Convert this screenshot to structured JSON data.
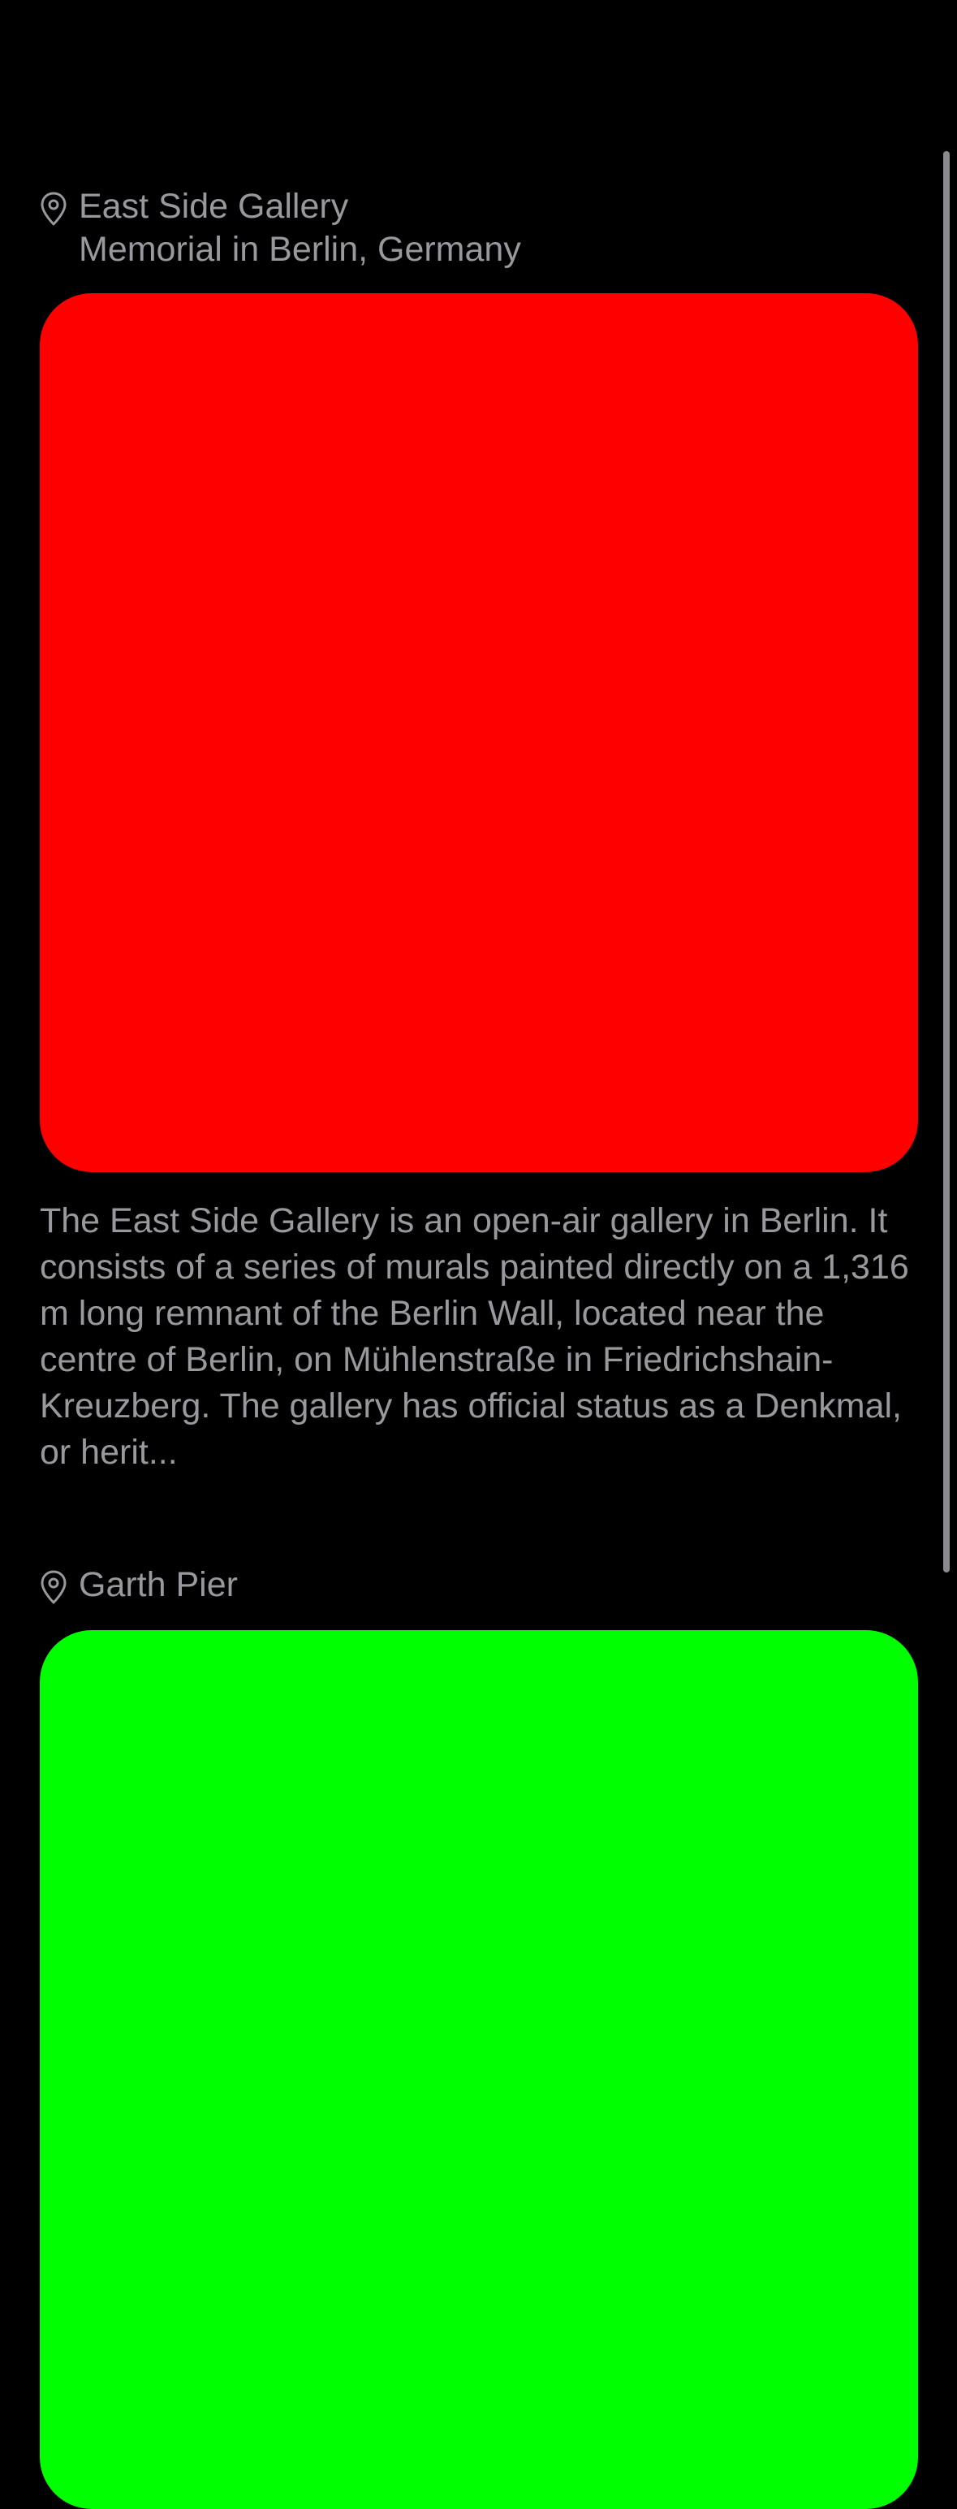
{
  "feed": {
    "items": [
      {
        "place_name": "East Side Gallery",
        "place_subtitle": "Memorial in Berlin, Germany",
        "media_color": "#ff0000",
        "icon": "map-pin-icon",
        "description": "The East Side Gallery is an open-air gallery in Berlin. It consists of a series of murals painted directly on a 1,316 m long remnant of the Berlin Wall, located near the centre of Berlin, on Mühlenstraße in Friedrichshain-Kreuzberg. The gallery has official status as a Denkmal, or herit..."
      },
      {
        "place_name": "Garth Pier",
        "media_color": "#00ff00",
        "icon": "map-pin-icon"
      }
    ]
  },
  "colors": {
    "background": "#000000",
    "text_secondary": "#98989d",
    "scrollbar": "#8a8a8e"
  }
}
